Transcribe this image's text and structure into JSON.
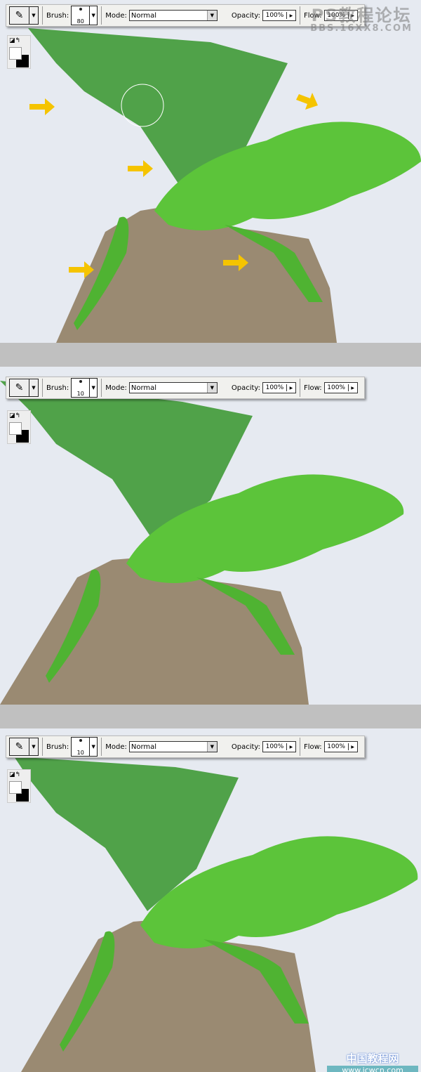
{
  "panels": [
    {
      "brush_size": "80",
      "mode": "Normal",
      "opacity": "100%",
      "flow": "100%",
      "labels": {
        "brush": "Brush:",
        "mode": "Mode:",
        "opacity": "Opacity:",
        "flow": "Flow:"
      }
    },
    {
      "brush_size": "10",
      "mode": "Normal",
      "opacity": "100%",
      "flow": "100%",
      "labels": {
        "brush": "Brush:",
        "mode": "Mode:",
        "opacity": "Opacity:",
        "flow": "Flow:"
      }
    },
    {
      "brush_size": "10",
      "mode": "Normal",
      "opacity": "100%",
      "flow": "100%",
      "labels": {
        "brush": "Brush:",
        "mode": "Mode:",
        "opacity": "Opacity:",
        "flow": "Flow:"
      }
    }
  ],
  "watermarks": {
    "top_cn": "PS教程论坛",
    "top_url": "BBS.16XX8.COM",
    "bottom_cn": "中国教程网",
    "bottom_url": "www.jcwcn.com"
  },
  "colors": {
    "arrow": "#f5c400",
    "wing": "#3f9a36",
    "lizard": "#5cc43a",
    "stone": "#9a8a72",
    "sky": "#e6eaf1",
    "separator": "#c0c0c0"
  },
  "icons": {
    "tool": "brush-icon",
    "annotation": "arrow-right-icon"
  }
}
